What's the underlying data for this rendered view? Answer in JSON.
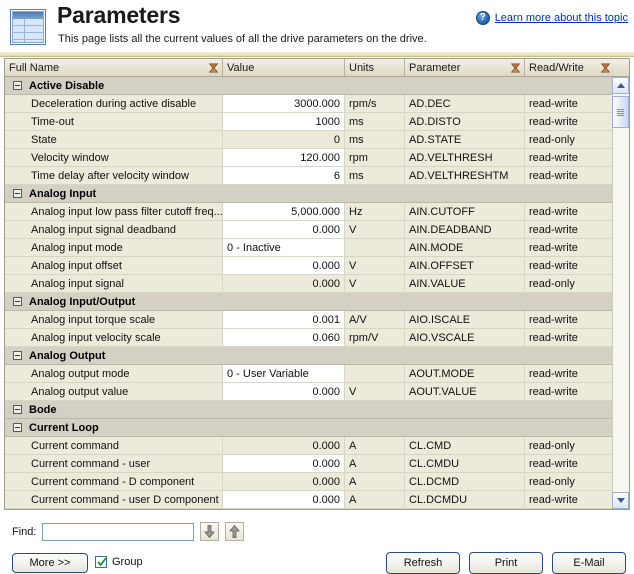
{
  "header": {
    "title": "Parameters",
    "subtitle": "This page lists all the current values of all the drive parameters on the drive.",
    "help_link": "Learn more about this topic",
    "icon": "table-grid-icon",
    "help_glyph": "?"
  },
  "grid": {
    "columns": [
      {
        "label": "Full Name",
        "filter": true
      },
      {
        "label": "Value",
        "filter": false
      },
      {
        "label": "Units",
        "filter": false
      },
      {
        "label": "Parameter",
        "filter": true
      },
      {
        "label": "Read/Write",
        "filter": true
      }
    ],
    "rows": [
      {
        "type": "group",
        "label": "Active Disable"
      },
      {
        "type": "data",
        "name": "Deceleration during active disable",
        "value": "3000.000",
        "units": "rpm/s",
        "parameter": "AD.DEC",
        "rw": "read-write",
        "editable": true
      },
      {
        "type": "data",
        "name": "Time-out",
        "value": "1000",
        "units": "ms",
        "parameter": "AD.DISTO",
        "rw": "read-write",
        "editable": true
      },
      {
        "type": "data",
        "name": "State",
        "value": "0",
        "units": "ms",
        "parameter": "AD.STATE",
        "rw": "read-only",
        "editable": false
      },
      {
        "type": "data",
        "name": "Velocity window",
        "value": "120.000",
        "units": "rpm",
        "parameter": "AD.VELTHRESH",
        "rw": "read-write",
        "editable": true
      },
      {
        "type": "data",
        "name": "Time delay after velocity window",
        "value": "6",
        "units": "ms",
        "parameter": "AD.VELTHRESHTM",
        "rw": "read-write",
        "editable": true
      },
      {
        "type": "group",
        "label": "Analog Input"
      },
      {
        "type": "data",
        "name": "Analog input low pass filter cutoff freq...",
        "value": "5,000.000",
        "units": "Hz",
        "parameter": "AIN.CUTOFF",
        "rw": "read-write",
        "editable": true
      },
      {
        "type": "data",
        "name": "Analog input signal deadband",
        "value": "0.000",
        "units": "V",
        "parameter": "AIN.DEADBAND",
        "rw": "read-write",
        "editable": true
      },
      {
        "type": "data",
        "name": "Analog input mode",
        "value": "0 - Inactive",
        "units": "",
        "parameter": "AIN.MODE",
        "rw": "read-write",
        "editable": true,
        "align": "left"
      },
      {
        "type": "data",
        "name": "Analog input offset",
        "value": "0.000",
        "units": "V",
        "parameter": "AIN.OFFSET",
        "rw": "read-write",
        "editable": true
      },
      {
        "type": "data",
        "name": "Analog input signal",
        "value": "0.000",
        "units": "V",
        "parameter": "AIN.VALUE",
        "rw": "read-only",
        "editable": false
      },
      {
        "type": "group",
        "label": "Analog Input/Output"
      },
      {
        "type": "data",
        "name": "Analog input torque scale",
        "value": "0.001",
        "units": "A/V",
        "parameter": "AIO.ISCALE",
        "rw": "read-write",
        "editable": true
      },
      {
        "type": "data",
        "name": "Analog input velocity scale",
        "value": "0.060",
        "units": "rpm/V",
        "parameter": "AIO.VSCALE",
        "rw": "read-write",
        "editable": true
      },
      {
        "type": "group",
        "label": "Analog Output"
      },
      {
        "type": "data",
        "name": "Analog output mode",
        "value": "0 - User Variable",
        "units": "",
        "parameter": "AOUT.MODE",
        "rw": "read-write",
        "editable": true,
        "align": "left"
      },
      {
        "type": "data",
        "name": "Analog output value",
        "value": "0.000",
        "units": "V",
        "parameter": "AOUT.VALUE",
        "rw": "read-write",
        "editable": true
      },
      {
        "type": "group",
        "label": "Bode"
      },
      {
        "type": "group",
        "label": "Current Loop"
      },
      {
        "type": "data",
        "name": "Current command",
        "value": "0.000",
        "units": "A",
        "parameter": "CL.CMD",
        "rw": "read-only",
        "editable": false
      },
      {
        "type": "data",
        "name": "Current command - user",
        "value": "0.000",
        "units": "A",
        "parameter": "CL.CMDU",
        "rw": "read-write",
        "editable": true
      },
      {
        "type": "data",
        "name": "Current command - D component",
        "value": "0.000",
        "units": "A",
        "parameter": "CL.DCMD",
        "rw": "read-only",
        "editable": false
      },
      {
        "type": "data",
        "name": "Current command - user D component",
        "value": "0.000",
        "units": "A",
        "parameter": "CL.DCMDU",
        "rw": "read-write",
        "editable": true
      }
    ]
  },
  "find": {
    "label": "Find:",
    "value": "",
    "placeholder": "",
    "next_icon": "arrow-down-icon",
    "prev_icon": "arrow-up-icon"
  },
  "footer": {
    "more_label": "More >>",
    "group_label": "Group",
    "group_checked": true,
    "refresh_label": "Refresh",
    "print_label": "Print",
    "email_label": "E-Mail"
  },
  "colors": {
    "link": "#0033aa",
    "group_row": "#d4d0c4",
    "readonly_cell": "#eceada",
    "editable_cell": "#ffffff",
    "funnel": "#9a5a2e"
  }
}
